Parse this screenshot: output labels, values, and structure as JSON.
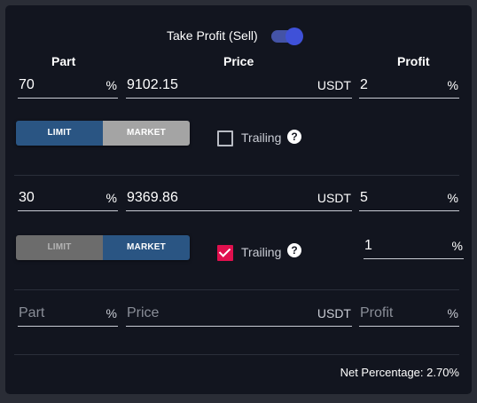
{
  "header": {
    "title": "Take Profit (Sell)",
    "toggle_on": true
  },
  "columns": {
    "part": "Part",
    "price": "Price",
    "profit": "Profit"
  },
  "row1": {
    "part": "70",
    "part_unit": "%",
    "price": "9102.15",
    "price_unit": "USDT",
    "profit": "2",
    "profit_unit": "%",
    "limit_label": "LIMIT",
    "market_label": "MARKET",
    "selected": "LIMIT",
    "trailing_label": "Trailing",
    "trailing_checked": false,
    "help_glyph": "?"
  },
  "row2": {
    "part": "30",
    "part_unit": "%",
    "price": "9369.86",
    "price_unit": "USDT",
    "profit": "5",
    "profit_unit": "%",
    "limit_label": "LIMIT",
    "market_label": "MARKET",
    "selected": "MARKET",
    "trailing_label": "Trailing",
    "trailing_checked": true,
    "help_glyph": "?",
    "trailing_value": "1",
    "trailing_unit": "%"
  },
  "new_row": {
    "part_placeholder": "Part",
    "part_unit": "%",
    "price_placeholder": "Price",
    "price_unit": "USDT",
    "profit_placeholder": "Profit",
    "profit_unit": "%"
  },
  "footer": {
    "net_percentage": "Net Percentage: 2.70%"
  },
  "colors": {
    "panel": "#12151f",
    "accent": "#2a5583",
    "toggle": "#3f51d8",
    "checkbox_checked": "#e0104e"
  }
}
